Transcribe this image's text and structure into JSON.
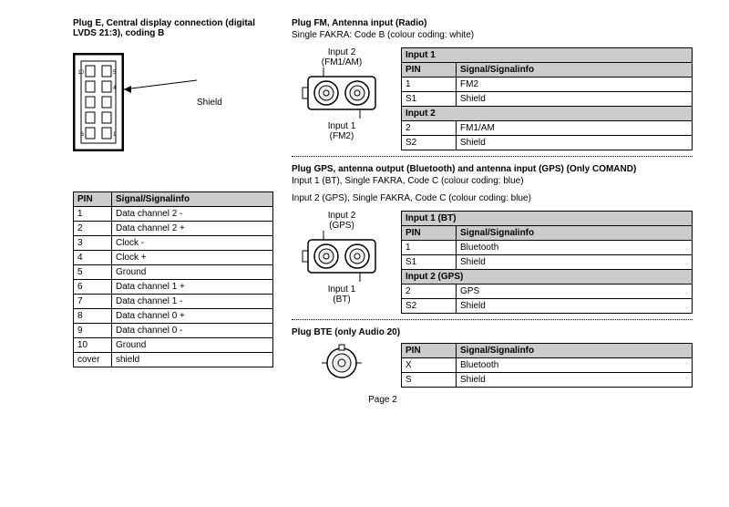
{
  "plugE": {
    "title": "Plug E, Central display connection (digital LVDS 21:3), coding B",
    "shield_label": "Shield",
    "table_headers": {
      "pin": "PIN",
      "signal": "Signal/Signalinfo"
    },
    "rows": [
      {
        "pin": "1",
        "signal": "Data channel 2 -"
      },
      {
        "pin": "2",
        "signal": "Data channel 2 +"
      },
      {
        "pin": "3",
        "signal": "Clock -"
      },
      {
        "pin": "4",
        "signal": "Clock +"
      },
      {
        "pin": "5",
        "signal": "Ground"
      },
      {
        "pin": "6",
        "signal": "Data channel 1 +"
      },
      {
        "pin": "7",
        "signal": "Data channel 1 -"
      },
      {
        "pin": "8",
        "signal": "Data channel 0 +"
      },
      {
        "pin": "9",
        "signal": "Data channel 0 -"
      },
      {
        "pin": "10",
        "signal": "Ground"
      },
      {
        "pin": "cover",
        "signal": "shield"
      }
    ]
  },
  "plugFM": {
    "title": "Plug FM, Antenna input (Radio)",
    "subtitle": "Single FAKRA: Code B (colour coding: white)",
    "diagram_labels": {
      "top": "Input 2",
      "top2": "(FM1/AM)",
      "bottom": "Input 1",
      "bottom2": "(FM2)"
    },
    "table_headers": {
      "pin": "PIN",
      "signal": "Signal/Signalinfo"
    },
    "section1": "Input 1",
    "rows1": [
      {
        "pin": "1",
        "signal": "FM2"
      },
      {
        "pin": "S1",
        "signal": "Shield"
      }
    ],
    "section2": "Input 2",
    "rows2": [
      {
        "pin": "2",
        "signal": "FM1/AM"
      },
      {
        "pin": "S2",
        "signal": "Shield"
      }
    ]
  },
  "plugGPS": {
    "title": "Plug GPS, antenna output (Bluetooth) and antenna input (GPS) (Only COMAND)",
    "line1": "Input 1 (BT), Single FAKRA, Code C (colour coding: blue)",
    "line2": "Input 2 (GPS), Single FAKRA, Code C (colour coding: blue)",
    "diagram_labels": {
      "top": "Input 2",
      "top2": "(GPS)",
      "bottom": "Input 1",
      "bottom2": "(BT)"
    },
    "table_headers": {
      "pin": "PIN",
      "signal": "Signal/Signalinfo"
    },
    "section1": "Input 1 (BT)",
    "rows1": [
      {
        "pin": "1",
        "signal": "Bluetooth"
      },
      {
        "pin": "S1",
        "signal": "Shield"
      }
    ],
    "section2": "Input 2 (GPS)",
    "rows2": [
      {
        "pin": "2",
        "signal": "GPS"
      },
      {
        "pin": "S2",
        "signal": "Shield"
      }
    ]
  },
  "plugBTE": {
    "title": "Plug BTE (only Audio 20)",
    "table_headers": {
      "pin": "PIN",
      "signal": "Signal/Signalinfo"
    },
    "rows": [
      {
        "pin": "X",
        "signal": "Bluetooth"
      },
      {
        "pin": "S",
        "signal": "Shield"
      }
    ]
  },
  "page": "Page 2"
}
